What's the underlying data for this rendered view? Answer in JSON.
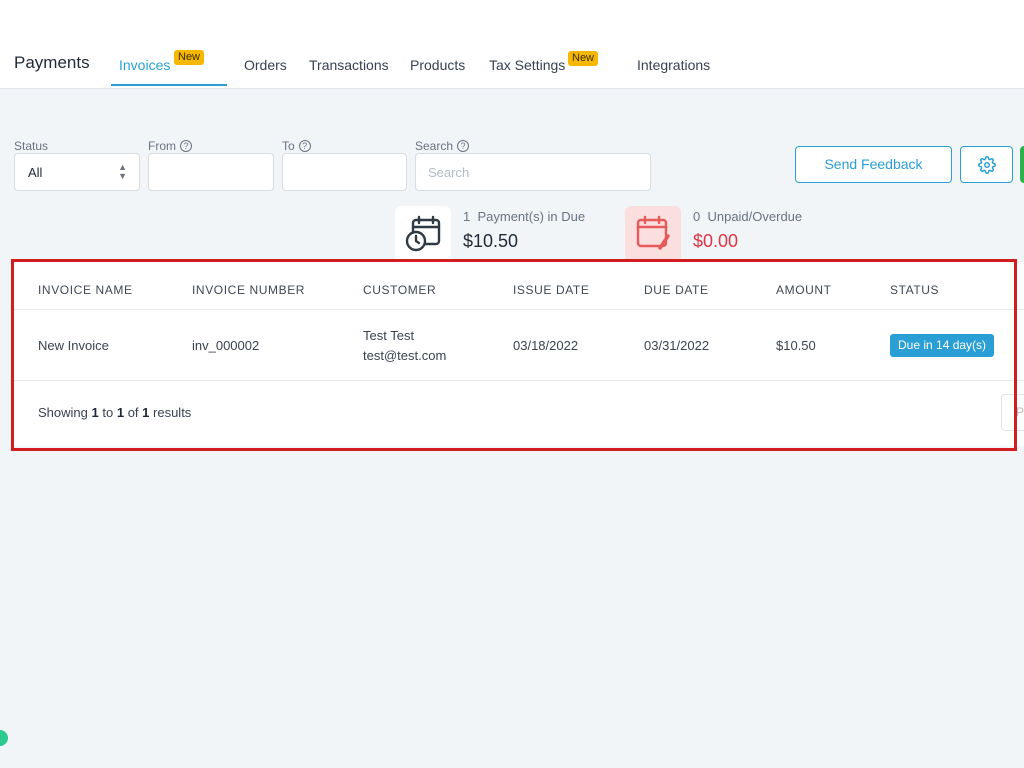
{
  "header": {
    "title": "Payments",
    "tabs": [
      {
        "label": "Invoices",
        "badge": "New",
        "active": true
      },
      {
        "label": "Orders"
      },
      {
        "label": "Transactions"
      },
      {
        "label": "Products"
      },
      {
        "label": "Tax Settings",
        "badge": "New"
      },
      {
        "label": "Integrations"
      }
    ]
  },
  "filters": {
    "status": {
      "label": "Status",
      "value": "All"
    },
    "from": {
      "label": "From",
      "value": ""
    },
    "to": {
      "label": "To",
      "value": ""
    },
    "search": {
      "label": "Search",
      "placeholder": "Search"
    }
  },
  "actions": {
    "feedback_label": "Send Feedback",
    "settings_icon": "gear-icon"
  },
  "stats": [
    {
      "count": "1",
      "label": "Payment(s) in Due",
      "value": "$10.50",
      "icon": "calendar-clock-icon"
    },
    {
      "count": "0",
      "label": "Unpaid/Overdue",
      "value": "$0.00",
      "icon": "calendar-edit-icon",
      "color": "#dc3545"
    }
  ],
  "table": {
    "columns": [
      "INVOICE NAME",
      "INVOICE NUMBER",
      "CUSTOMER",
      "ISSUE DATE",
      "DUE DATE",
      "AMOUNT",
      "STATUS"
    ],
    "rows": [
      {
        "invoice_name": "New Invoice",
        "invoice_number": "inv_000002",
        "customer_name": "Test Test",
        "customer_email": "test@test.com",
        "issue_date": "03/18/2022",
        "due_date": "03/31/2022",
        "amount": "$10.50",
        "status": "Due in 14 day(s)"
      }
    ],
    "footer": {
      "prefix": "Showing",
      "from": "1",
      "to_word": "to",
      "to": "1",
      "of_word": "of",
      "total": "1",
      "suffix": "results"
    },
    "pager_label": "P"
  },
  "colors": {
    "accent": "#2a9fd6",
    "badge": "#f5b700",
    "danger": "#dc3545",
    "highlight": "#d11d1d"
  }
}
